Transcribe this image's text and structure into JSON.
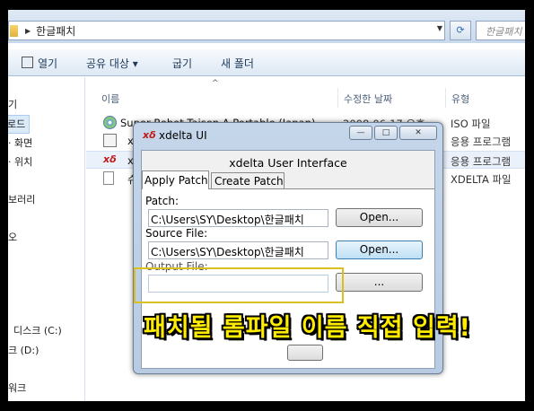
{
  "explorer": {
    "address": {
      "path": "한글패치",
      "dropdown_icon": "chevron-down-icon"
    },
    "refresh_icon": "refresh-icon",
    "search_placeholder": "한글패치",
    "toolbar": {
      "open": "열기",
      "share": "공유 대상 ▾",
      "burn": "굽기",
      "new_folder": "새 폴더"
    },
    "nav": {
      "items": [
        "즐겨찾기",
        "다운로드",
        "바탕 화면",
        "최근 위치",
        "라이브러리",
        "비디오",
        "로컬 디스크 (C:)",
        "로컬 디스크 (D:)",
        "네트워크"
      ],
      "visible": [
        "기",
        "로드",
        "· 화면",
        "· 위치",
        "보러리",
        "오",
        "디스크 (C:)",
        "크 (D:)",
        "워크"
      ]
    },
    "columns": {
      "name": "이름",
      "date": "수정한 날짜",
      "type": "유형"
    },
    "files": [
      {
        "name": "Super Robot Taisen A Portable (Japan)",
        "date": "2008-06-17 오후...",
        "type": "ISO 파일"
      },
      {
        "name": "xde",
        "date": "",
        "type": "응용 프로그램"
      },
      {
        "name": "xde",
        "date": "",
        "type": "응용 프로그램"
      },
      {
        "name": "슈",
        "date": "",
        "type": "XDELTA 파일"
      }
    ]
  },
  "xdelta": {
    "title": "xdelta UI",
    "heading": "xdelta User Interface",
    "tabs": {
      "apply": "Apply Patch",
      "create": "Create Patch"
    },
    "patch": {
      "label": "Patch:",
      "value": "C:\\Users\\SY\\Desktop\\한글패치",
      "button": "Open..."
    },
    "source": {
      "label": "Source File:",
      "value": "C:\\Users\\SY\\Desktop\\한글패치",
      "button": "Open..."
    },
    "output": {
      "label": "Output File:",
      "value": "",
      "button": "..."
    }
  },
  "caption": "패치될 롬파일 이름 직접 입력!",
  "colors": {
    "caption": "#ffec00",
    "highlight": "#d9c020"
  }
}
